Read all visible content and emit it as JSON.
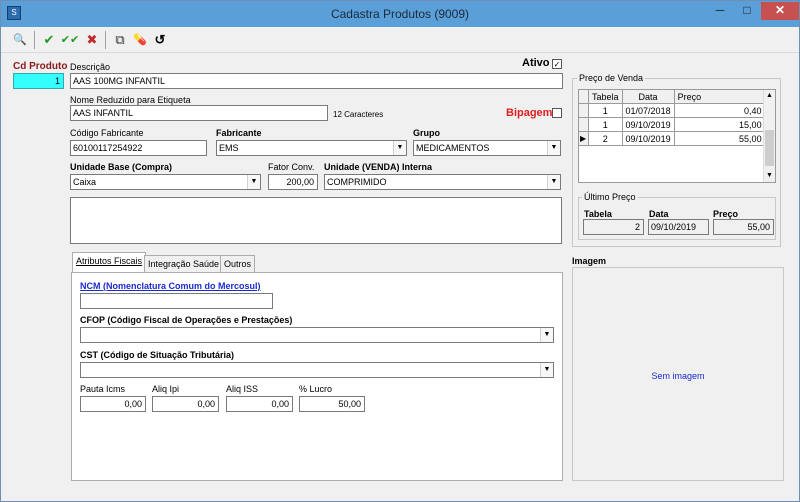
{
  "window": {
    "title": "Cadastra Produtos (9009)",
    "min": "─",
    "max": "□",
    "close": "✕",
    "app_icon": "S"
  },
  "toolbar": {
    "search": "🔍",
    "confirm": "✔",
    "confirm_all": "✔✔",
    "cancel": "✖",
    "copy": "⧉",
    "pills": "💊",
    "history": "↺"
  },
  "form": {
    "cd_produto_label": "Cd Produto",
    "cd_produto_value": "1",
    "descricao_label": "Descrição",
    "descricao_value": "AAS 100MG INFANTIL",
    "ativo_label": "Ativo",
    "ativo_checked": "✓",
    "nome_reduzido_label": "Nome Reduzido para Etiqueta",
    "nome_reduzido_value": "AAS INFANTIL",
    "caracteres": "12 Caracteres",
    "bipagem_label": "Bipagem",
    "codigo_fabricante_label": "Código Fabricante",
    "codigo_fabricante_value": "60100117254922",
    "fabricante_label": "Fabricante",
    "fabricante_value": "EMS",
    "grupo_label": "Grupo",
    "grupo_value": "MEDICAMENTOS",
    "unidade_base_label": "Unidade Base (Compra)",
    "unidade_base_value": "Caixa",
    "fator_conv_label": "Fator Conv.",
    "fator_conv_value": "200,00",
    "unidade_venda_label": "Unidade (VENDA) Interna",
    "unidade_venda_value": "COMPRIMIDO"
  },
  "preco_venda": {
    "title": "Preço de Venda",
    "headers": [
      "Tabela",
      "Data",
      "Preço"
    ],
    "rows": [
      {
        "tabela": "1",
        "data": "01/07/2018",
        "preco": "0,40"
      },
      {
        "tabela": "1",
        "data": "09/10/2019",
        "preco": "15,00"
      },
      {
        "tabela": "2",
        "data": "09/10/2019",
        "preco": "55,00"
      }
    ]
  },
  "ultimo_preco": {
    "title": "Último Preço",
    "tabela_label": "Tabela",
    "data_label": "Data",
    "preco_label": "Preço",
    "tabela_value": "2",
    "data_value": "09/10/2019",
    "preco_value": "55,00"
  },
  "tabs": [
    "Atributos Fiscais",
    "Integração Saúde",
    "Outros"
  ],
  "fiscal": {
    "ncm_link": "NCM (Nomenclatura Comum do Mercosul)",
    "ncm_value": "",
    "cfop_label": "CFOP (Código Fiscal de Operações e Prestações)",
    "cfop_value": "",
    "cst_label": "CST (Código de Situação Tributária)",
    "cst_value": "",
    "pauta_icms_label": "Pauta Icms",
    "pauta_icms_value": "0,00",
    "aliq_ipi_label": "Aliq Ipi",
    "aliq_ipi_value": "0,00",
    "aliq_iss_label": "Aliq ISS",
    "aliq_iss_value": "0,00",
    "lucro_label": "% Lucro",
    "lucro_value": "50,00"
  },
  "imagem": {
    "label": "Imagem",
    "placeholder": "Sem imagem"
  },
  "colors": {
    "cd_field": "#33ffff",
    "bipagem": "#e02020",
    "link": "#1a2ad0",
    "title_bar": "#5a9fd8"
  }
}
